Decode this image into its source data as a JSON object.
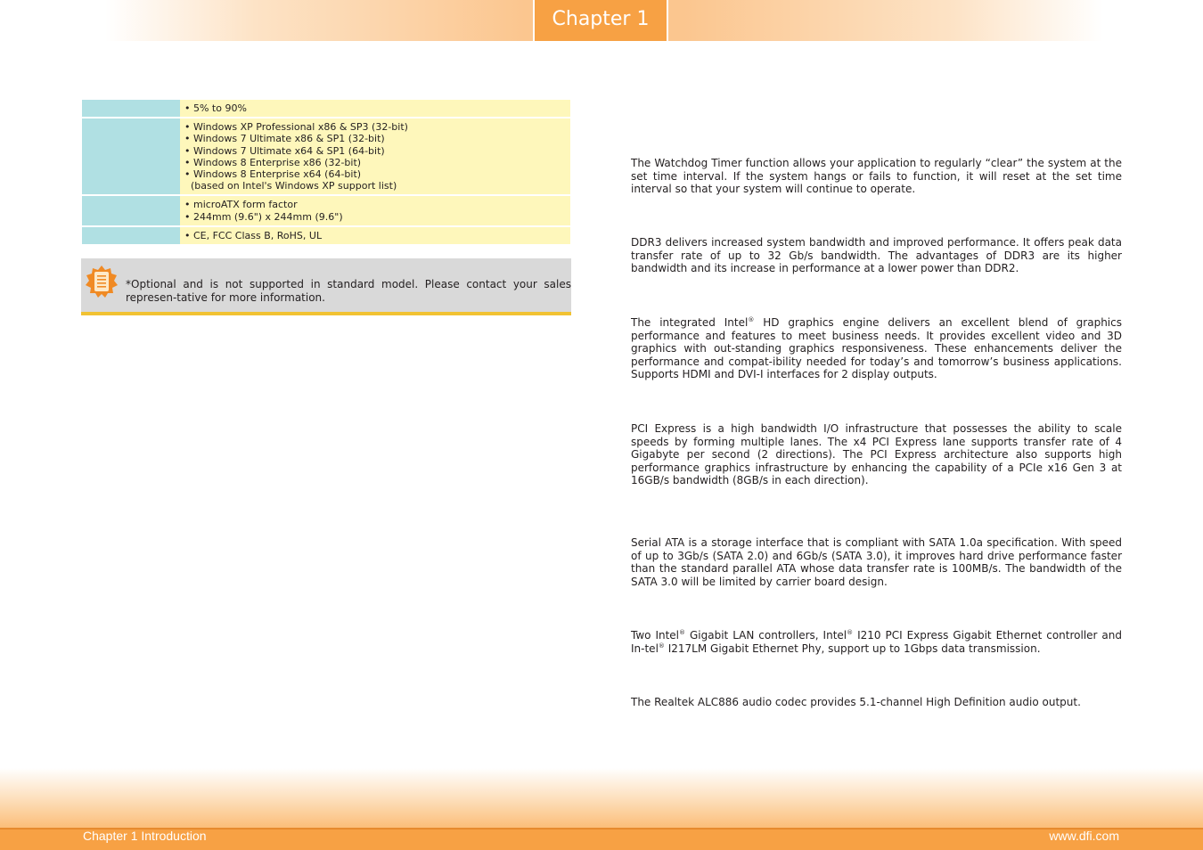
{
  "header": {
    "chapter_label": "Chapter 1"
  },
  "spec_table": {
    "rows": [
      {
        "lines": [
          "• 5% to 90%"
        ]
      },
      {
        "lines": [
          "• Windows XP Professional x86 & SP3 (32-bit)",
          "• Windows 7 Ultimate x86 & SP1 (32-bit)",
          "• Windows 7 Ultimate x64 & SP1 (64-bit)",
          "• Windows 8 Enterprise x86 (32-bit)",
          "• Windows 8 Enterprise x64 (64-bit)",
          "  (based on Intel's Windows XP support list)"
        ]
      },
      {
        "lines": [
          "• microATX form factor",
          "• 244mm (9.6\") x 244mm (9.6\")"
        ]
      },
      {
        "lines": [
          "• CE, FCC Class B, RoHS, UL"
        ]
      }
    ]
  },
  "note": {
    "icon": "note-icon",
    "text": "*Optional and is not supported in standard model. Please contact your sales represen-tative for more information."
  },
  "features": {
    "watchdog": "The Watchdog Timer function allows your application to regularly “clear” the system at the set time interval. If the system hangs or fails to function, it will reset at the set time interval so that your system will continue to operate.",
    "ddr3": "DDR3 delivers increased system bandwidth and improved performance. It offers peak data transfer rate of up to 32 Gb/s bandwidth. The advantages of DDR3 are its higher bandwidth and its increase in performance at a lower power than DDR2.",
    "graphics_pre": "The integrated Intel",
    "graphics_post": " HD graphics engine delivers an excellent blend of graphics performance and features to meet business needs. It provides  excellent video and 3D graphics with out-standing graphics responsiveness. These enhancements deliver the performance and compat-ibility needed for today’s and tomorrow’s business applications. Supports HDMI and DVI-I interfaces for 2 display outputs.",
    "pcie": "PCI Express is a high bandwidth I/O infrastructure that possesses the ability to scale speeds by forming multiple lanes. The x4 PCI Express lane supports transfer rate of 4 Gigabyte per second (2 directions). The PCI Express architecture also supports high performance graphics infrastructure by enhancing the capability of a PCIe x16 Gen 3 at 16GB/s bandwidth (8GB/s in each direction).",
    "sata": "Serial ATA is a storage interface that is compliant with SATA 1.0a specification. With speed of up to 3Gb/s (SATA 2.0) and 6Gb/s (SATA 3.0), it improves hard drive performance faster than the standard parallel ATA whose data transfer rate is 100MB/s. The bandwidth of the SATA 3.0 will be limited by carrier board design.",
    "lan_a": "Two Intel",
    "lan_b": " Gigabit LAN controllers, Intel",
    "lan_c": " I210 PCI Express Gigabit Ethernet controller and In-tel",
    "lan_d": " I217LM Gigabit Ethernet Phy, support up to 1Gbps data transmission.",
    "registered": "®",
    "audio": "The Realtek ALC886 audio codec provides 5.1-channel High Definition audio output."
  },
  "footer": {
    "left": "Chapter 1 Introduction",
    "right": "www.dfi.com"
  },
  "colors": {
    "accent_orange": "#f7a144",
    "table_label": "#b0e0e3",
    "table_value": "#fef7bb",
    "note_bg": "#d9d9d9",
    "note_rule": "#f1c232"
  }
}
